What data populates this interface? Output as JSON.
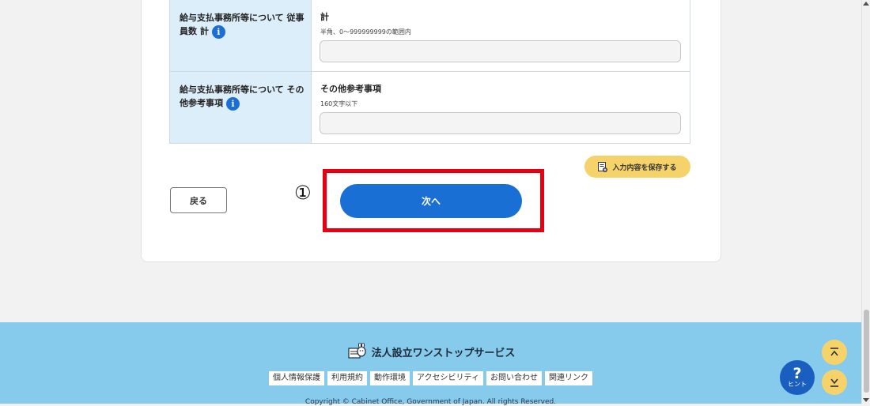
{
  "form": {
    "rows": [
      {
        "label": "給与支払事務所等について 従事員数 計",
        "field_title": "計",
        "field_hint": "半角、0〜999999999の範囲内",
        "value": ""
      },
      {
        "label": "給与支払事務所等について その他参考事項",
        "field_title": "その他参考事項",
        "field_hint": "160文字以下",
        "value": ""
      }
    ],
    "info_icon_glyph": "i"
  },
  "actions": {
    "save_label": "入力内容を保存する",
    "back_label": "戻る",
    "next_label": "次へ",
    "step_marker": "①",
    "highlight_color": "#e60012"
  },
  "footer": {
    "service_name": "法人設立ワンストップサービス",
    "links": [
      "個人情報保護",
      "利用規約",
      "動作環境",
      "アクセシビリティ",
      "お問い合わせ",
      "関連リンク"
    ],
    "copyright": "Copyright © Cabinet Office, Government of Japan. All rights Reserved."
  },
  "floating": {
    "hint_symbol": "?",
    "hint_label": "ヒント"
  },
  "colors": {
    "primary": "#1a6fd4",
    "accent_yellow": "#f5d36a",
    "footer_bg": "#86caec",
    "table_header_bg": "#ddeefb"
  },
  "icons": [
    "info-icon",
    "save-icon",
    "logo-icon",
    "chevron-up-icon",
    "chevron-down-icon"
  ]
}
